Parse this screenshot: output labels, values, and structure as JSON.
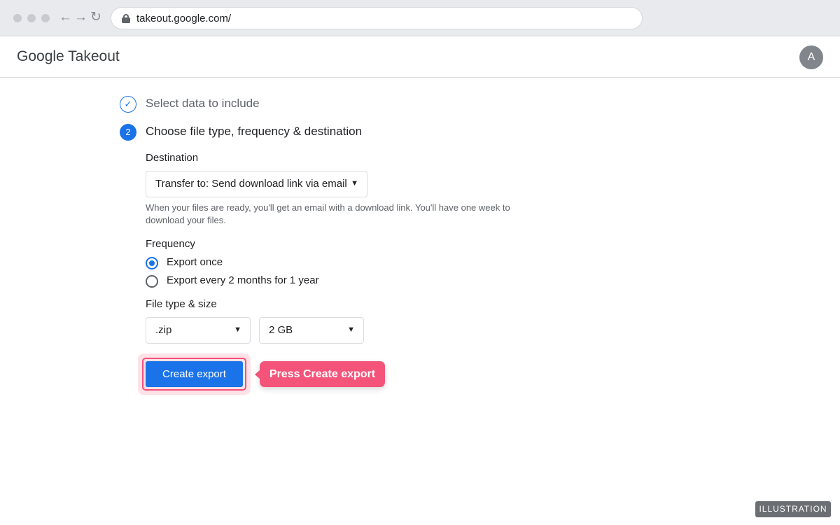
{
  "browser": {
    "url": "takeout.google.com/",
    "back_icon": "←",
    "forward_icon": "→",
    "reload_icon": "↻"
  },
  "header": {
    "title": "Google Takeout",
    "avatar_initial": "A"
  },
  "steps": [
    {
      "marker": "✓",
      "label": "Select data to include"
    },
    {
      "marker": "2",
      "label": "Choose file type, frequency & destination"
    }
  ],
  "destination": {
    "label": "Destination",
    "selected": "Transfer to: Send download link via email",
    "helper": "When your files are ready, you'll get an email with a download link. You'll have one week to download your files."
  },
  "frequency": {
    "label": "Frequency",
    "options": [
      {
        "label": "Export once",
        "checked": true
      },
      {
        "label": "Export every 2 months for 1 year",
        "checked": false
      }
    ]
  },
  "filetype": {
    "label": "File type & size",
    "type_selected": ".zip",
    "size_selected": "2 GB"
  },
  "actions": {
    "create_label": "Create export"
  },
  "callout": {
    "text": "Press Create export"
  },
  "badge": {
    "text": "ILLUSTRATION"
  },
  "colors": {
    "accent": "#1a73e8",
    "highlight": "#f5547a"
  },
  "icons": {
    "caret": "▼"
  }
}
